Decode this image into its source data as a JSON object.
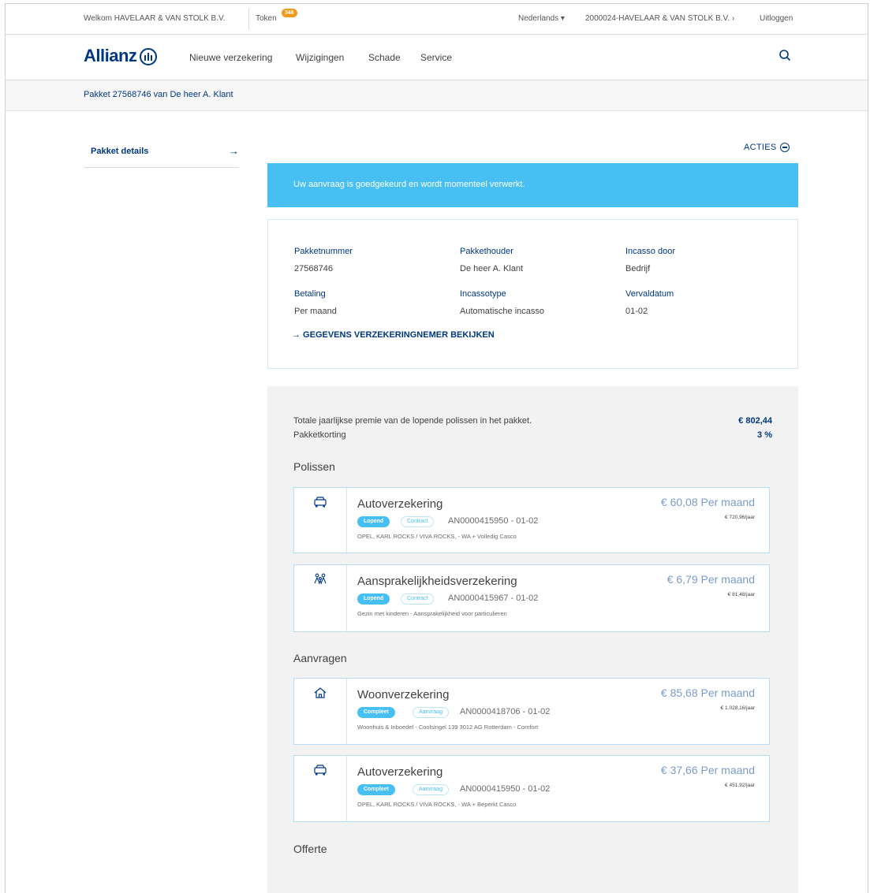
{
  "topbar": {
    "welcome": "Welkom HAVELAAR & VAN STOLK B.V.",
    "token_label": "Token",
    "token_count": "346",
    "language": "Nederlands ▾",
    "organisation": "2000024-HAVELAAR & VAN STOLK B.V. ›",
    "logout": "Uitloggen"
  },
  "nav": {
    "logo": "Allianz",
    "items": [
      "Nieuwe verzekering",
      "Wijzigingen",
      "Schade",
      "Service"
    ]
  },
  "breadcrumb": "Pakket 27568746 van De heer A. Klant",
  "sidebar": {
    "items": [
      {
        "label": "Pakket details"
      }
    ]
  },
  "actions_label": "ACTIES",
  "banner": "Uw aanvraag is goedgekeurd en wordt momenteel verwerkt.",
  "info": {
    "fields": [
      {
        "label": "Pakketnummer",
        "value": "27568746"
      },
      {
        "label": "Pakkethouder",
        "value": "De heer A. Klant"
      },
      {
        "label": "Incasso door",
        "value": "Bedrijf"
      },
      {
        "label": "Betaling",
        "value": "Per maand"
      },
      {
        "label": "Incassotype",
        "value": "Automatische incasso"
      },
      {
        "label": "Vervaldatum",
        "value": "01-02"
      }
    ],
    "link": "→ GEGEVENS VERZEKERINGNEMER BEKIJKEN"
  },
  "totals": {
    "premium_label": "Totale jaarlijkse premie van de lopende polissen in het pakket.",
    "premium_value": "€ 802,44",
    "discount_label": "Pakketkorting",
    "discount_value": "3 %"
  },
  "sections": {
    "polissen": "Polissen",
    "aanvragen": "Aanvragen",
    "offerte": "Offerte"
  },
  "polissen": [
    {
      "icon": "car-icon",
      "title": "Autoverzekering",
      "status": "Lopend",
      "type": "Contract",
      "number": "AN0000415950 - 01-02",
      "description": "OPEL, KARL ROCKS / VIVA ROCKS, - WA + Volledig Casco",
      "price": "€ 60,08 Per maand",
      "yearly": "€ 720,96/jaar"
    },
    {
      "icon": "family-icon",
      "title": "Aansprakelijkheidsverzekering",
      "status": "Lopend",
      "type": "Contract",
      "number": "AN0000415967 - 01-02",
      "description": "Gezin met kinderen - Aansprakelijkheid voor particulieren",
      "price": "€ 6,79 Per maand",
      "yearly": "€ 81,48/jaar"
    }
  ],
  "aanvragen": [
    {
      "icon": "house-icon",
      "title": "Woonverzekering",
      "status": "Compleet",
      "type": "Aanvraag",
      "number": "AN0000418706 - 01-02",
      "description": "Woonhuis & Inboedel - Coolsingel 139 3012 AG Rotterdam - Comfort",
      "price": "€ 85,68 Per maand",
      "yearly": "€ 1.028,16/jaar"
    },
    {
      "icon": "car-icon",
      "title": "Autoverzekering",
      "status": "Compleet",
      "type": "Aanvraag",
      "number": "AN0000415950 - 01-02",
      "description": "OPEL, KARL ROCKS / VIVA ROCKS, - WA + Beperkt Casco",
      "price": "€ 37,66 Per maand",
      "yearly": "€ 451,92/jaar"
    }
  ]
}
